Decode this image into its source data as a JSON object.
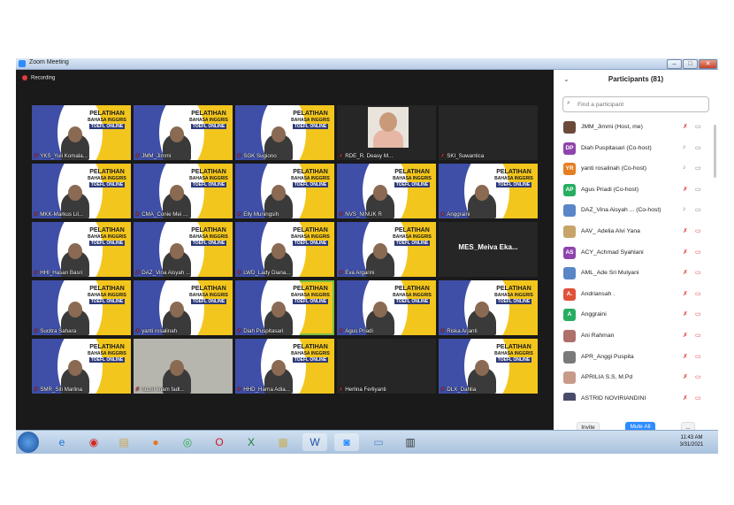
{
  "window": {
    "title": "Zoom Meeting",
    "min": "–",
    "max": "□",
    "close": "✕"
  },
  "recording": "Recording",
  "tile_text": {
    "l1": "PELATIHAN",
    "l2": "BAHASA INGGRIS",
    "l3": "TOEFL ONLINE"
  },
  "tiles": [
    "YKS_Yuli Komala...",
    "JMM_Jimmi",
    "SGK Sugiono",
    "RDE_R. Deasy M...",
    "SKI_Suwantica",
    "MKK-Markus Lil...",
    "CMA_Conie Mei ...",
    "Elly Muningsih",
    "NVS_NINUK R",
    "Anggraini",
    "HHI_Hasan Basri",
    "DAZ_Vina Aisyah ...",
    "LWD_Lady Diana...",
    "Eva Argarini",
    "MES_Meiva Eka...",
    "Sucitra Sahara",
    "yanti rosalinah",
    "Diah Puspitasari",
    "Agus Priadi",
    "Riska Arjanti",
    "SMR_Siti Marlina",
    "nuzul imam fadl...",
    "HHD_Harna Adia...",
    "Herlina Ferliyanti",
    "DLX_Dahlia"
  ],
  "participants": {
    "header": "Participants (81)",
    "search_placeholder": "Find a participant",
    "list": [
      {
        "initials": "",
        "name": "JMM_Jimmi (Host, me)",
        "color": "#6b4a3a"
      },
      {
        "initials": "DP",
        "name": "Diah Puspitasari (Co-host)",
        "color": "#8e44ad"
      },
      {
        "initials": "YR",
        "name": "yanti rosalinah (Co-host)",
        "color": "#e67e22"
      },
      {
        "initials": "AP",
        "name": "Agus Priadi (Co-host)",
        "color": "#27ae60"
      },
      {
        "initials": "",
        "name": "DAZ_Vina Aisyah ... (Co-host)",
        "color": "#5a86c8"
      },
      {
        "initials": "",
        "name": "AAV_ Adelia Alvi Yana",
        "color": "#c8a46a"
      },
      {
        "initials": "AS",
        "name": "ACY_Achmad Syahlani",
        "color": "#8e44ad"
      },
      {
        "initials": "",
        "name": "AML_Ade Sri Mulyani",
        "color": "#5a86c8"
      },
      {
        "initials": "A.",
        "name": "Andriansah .",
        "color": "#e0513a"
      },
      {
        "initials": "A",
        "name": "Anggraini",
        "color": "#27ae60"
      },
      {
        "initials": "",
        "name": "Ani Rahman",
        "color": "#b0706a"
      },
      {
        "initials": "",
        "name": "APR_Anggi Puspita",
        "color": "#7a7a7a"
      },
      {
        "initials": "",
        "name": "APRILIA S.S, M.Pd",
        "color": "#c89a8a"
      },
      {
        "initials": "",
        "name": "ASTRID NOVIRIANDINI",
        "color": "#4a4a6a"
      }
    ],
    "invite": "Invite",
    "mute_all": "Mute All",
    "more": "..."
  },
  "clock": {
    "time": "11:43 AM",
    "date": "3/31/2021"
  },
  "colors": {
    "zoom_blue": "#2d8cff",
    "tile_yellow": "#f3c61d",
    "muted_red": "#e23c3c"
  }
}
